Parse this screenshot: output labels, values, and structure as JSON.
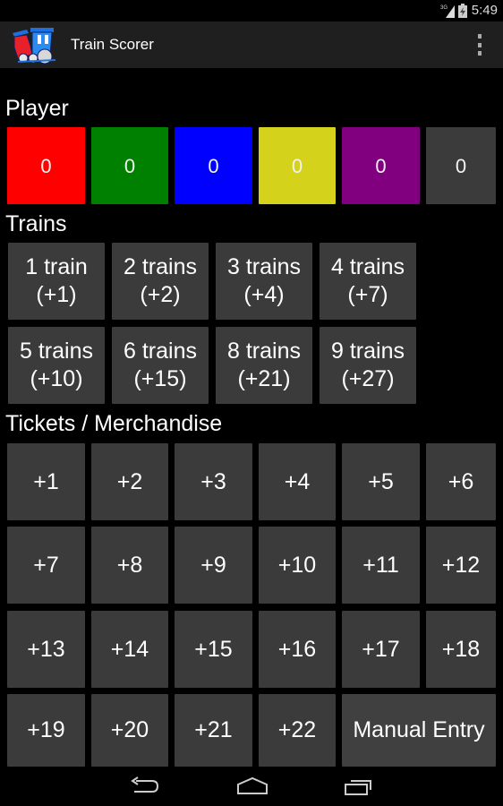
{
  "status_bar": {
    "clock": "5:49",
    "signal_icon": "signal-3g-icon",
    "battery_icon": "battery-charging-icon"
  },
  "action_bar": {
    "title": "Train Scorer",
    "app_icon": "train-logo-icon",
    "overflow_icon": "overflow-menu-icon"
  },
  "player": {
    "label": "Player",
    "players": [
      {
        "score": "0",
        "color": "#ff0000"
      },
      {
        "score": "0",
        "color": "#008000"
      },
      {
        "score": "0",
        "color": "#0000ff"
      },
      {
        "score": "0",
        "color": "#d4d21a"
      },
      {
        "score": "0",
        "color": "#800080"
      },
      {
        "score": "0",
        "color": "#3b3b3b"
      }
    ]
  },
  "trains": {
    "label": "Trains",
    "buttons": [
      {
        "line1": "1 train",
        "line2": "(+1)"
      },
      {
        "line1": "2 trains",
        "line2": "(+2)"
      },
      {
        "line1": "3 trains",
        "line2": "(+4)"
      },
      {
        "line1": "4 trains",
        "line2": "(+7)"
      },
      {
        "line1": "5 trains",
        "line2": "(+10)"
      },
      {
        "line1": "6 trains",
        "line2": "(+15)"
      },
      {
        "line1": "8 trains",
        "line2": "(+21)"
      },
      {
        "line1": "9 trains",
        "line2": "(+27)"
      }
    ]
  },
  "tickets": {
    "label": "Tickets / Merchandise",
    "buttons": [
      "+1",
      "+2",
      "+3",
      "+4",
      "+5",
      "+6",
      "+7",
      "+8",
      "+9",
      "+10",
      "+11",
      "+12",
      "+13",
      "+14",
      "+15",
      "+16",
      "+17",
      "+18",
      "+19",
      "+20",
      "+21",
      "+22"
    ],
    "manual_entry": "Manual Entry"
  },
  "nav_bar": {
    "back_icon": "back-icon",
    "home_icon": "home-icon",
    "recents_icon": "recents-icon"
  }
}
